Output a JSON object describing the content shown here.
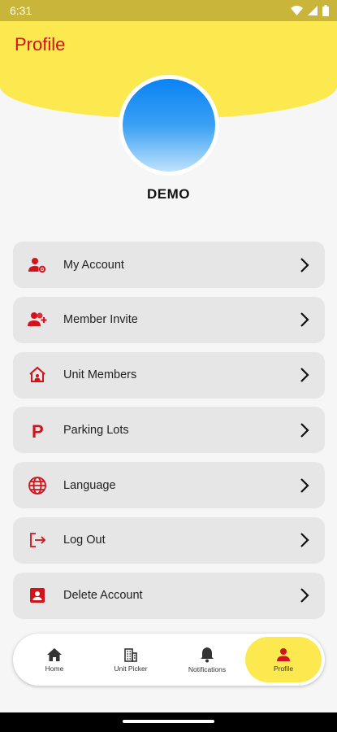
{
  "status_bar": {
    "time": "6:31"
  },
  "header": {
    "title": "Profile"
  },
  "profile": {
    "name": "DEMO"
  },
  "menu": {
    "items": [
      {
        "label": "My Account",
        "icon": "user-gear-icon"
      },
      {
        "label": "Member Invite",
        "icon": "user-add-icon"
      },
      {
        "label": "Unit Members",
        "icon": "home-users-icon"
      },
      {
        "label": "Parking Lots",
        "icon": "parking-icon"
      },
      {
        "label": "Language",
        "icon": "globe-icon"
      },
      {
        "label": "Log Out",
        "icon": "logout-icon"
      },
      {
        "label": "Delete Account",
        "icon": "account-box-icon"
      }
    ]
  },
  "bottom_nav": {
    "items": [
      {
        "label": "Home",
        "icon": "home-icon"
      },
      {
        "label": "Unit Picker",
        "icon": "building-icon"
      },
      {
        "label": "Notifications",
        "icon": "bell-icon"
      },
      {
        "label": "Profile",
        "icon": "person-icon",
        "active": true
      }
    ]
  },
  "colors": {
    "accent": "#d3121b",
    "header_yellow": "#fce94f",
    "status_bar": "#c9b53a"
  }
}
